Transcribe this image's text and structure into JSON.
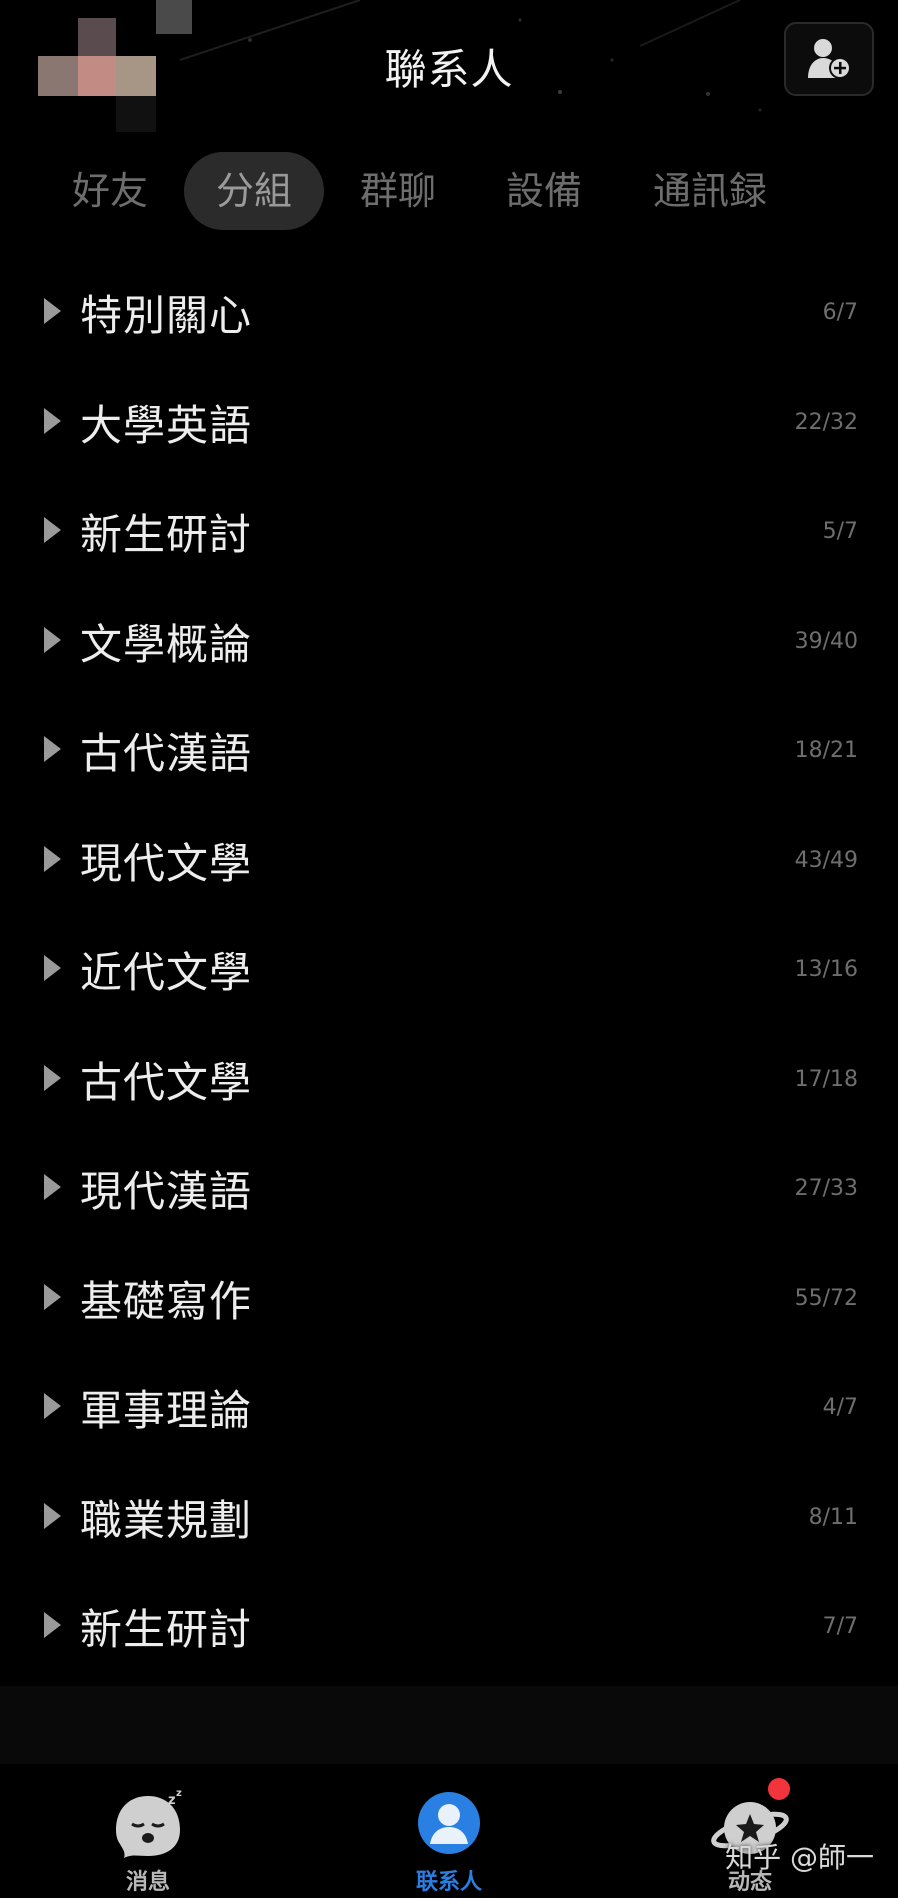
{
  "header": {
    "title": "聯系人",
    "add_friend_icon": "add-person-icon"
  },
  "tabs": [
    {
      "label": "好友",
      "active": false
    },
    {
      "label": "分組",
      "active": true
    },
    {
      "label": "群聊",
      "active": false
    },
    {
      "label": "設備",
      "active": false
    },
    {
      "label": "通訊録",
      "active": false
    }
  ],
  "groups": [
    {
      "name": "特別關心",
      "count": "6/7"
    },
    {
      "name": "大學英語",
      "count": "22/32"
    },
    {
      "name": "新生研討",
      "count": "5/7"
    },
    {
      "name": "文學概論",
      "count": "39/40"
    },
    {
      "name": "古代漢語",
      "count": "18/21"
    },
    {
      "name": "現代文學",
      "count": "43/49"
    },
    {
      "name": "近代文學",
      "count": "13/16"
    },
    {
      "name": "古代文學",
      "count": "17/18"
    },
    {
      "name": "現代漢語",
      "count": "27/33"
    },
    {
      "name": "基礎寫作",
      "count": "55/72"
    },
    {
      "name": "軍事理論",
      "count": "4/7"
    },
    {
      "name": "職業規劃",
      "count": "8/11"
    },
    {
      "name": "新生研討",
      "count": "7/7"
    }
  ],
  "bottom_nav": [
    {
      "label": "消息",
      "icon": "sleeping-penguin-icon",
      "active": false
    },
    {
      "label": "联系人",
      "icon": "contact-person-icon",
      "active": true
    },
    {
      "label": "动态",
      "icon": "planet-star-icon",
      "active": false,
      "badge": true
    }
  ],
  "watermark": "知乎 @師一",
  "colors": {
    "background": "#000000",
    "active_tab_bg": "#2b2b2b",
    "active_nav": "#2a7fe2",
    "badge": "#f2343d"
  }
}
